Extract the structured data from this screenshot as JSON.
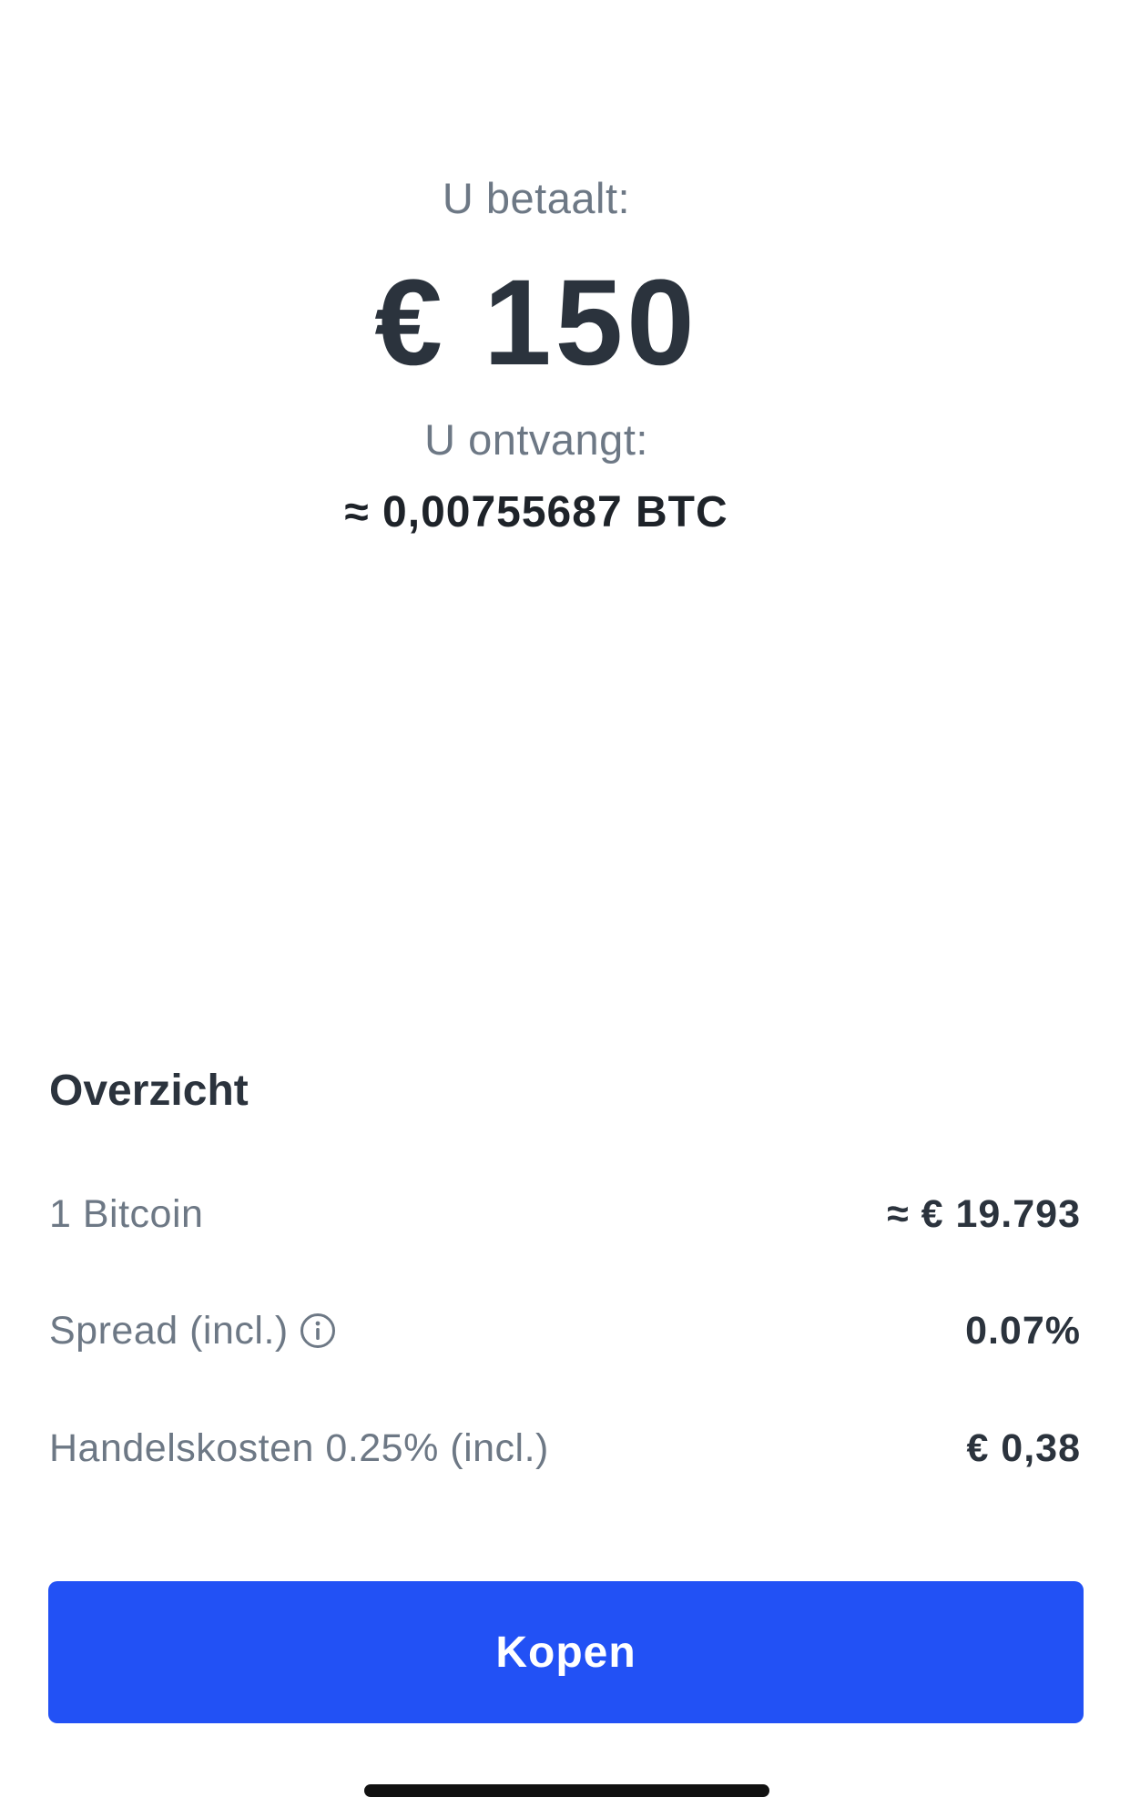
{
  "summary": {
    "pay_label": "U betaalt:",
    "pay_amount": "€ 150",
    "receive_label": "U ontvangt:",
    "receive_amount": "≈ 0,00755687 BTC"
  },
  "overview": {
    "title": "Overzicht",
    "rows": [
      {
        "label": "1 Bitcoin",
        "value": "≈ € 19.793"
      },
      {
        "label": "Spread (incl.)",
        "value": "0.07%",
        "icon": "info-icon"
      },
      {
        "label": "Handelskosten 0.25% (incl.)",
        "value": "€ 0,38"
      }
    ]
  },
  "actions": {
    "buy_label": "Kopen"
  },
  "colors": {
    "accent": "#2251f5",
    "text_primary": "#2b333d",
    "text_secondary": "#6d7885"
  }
}
